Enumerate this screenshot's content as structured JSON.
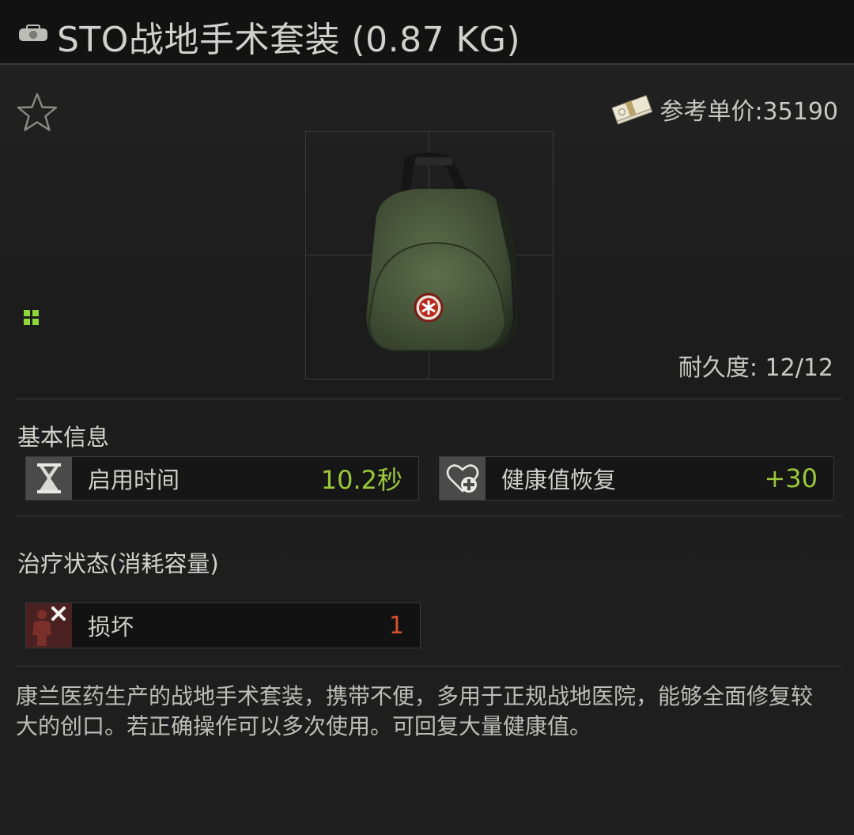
{
  "header": {
    "icon": "medkit-icon",
    "title": "STO战地手术套装 (0.87 KG)"
  },
  "top": {
    "favorite_icon": "star-outline-icon",
    "price_icon": "money-stack-icon",
    "price_label": "参考单价:35190",
    "grid_icon": "grid-squares-icon",
    "durability_label": "耐久度: 12/12"
  },
  "basic_info": {
    "title": "基本信息",
    "stats": [
      {
        "icon": "hourglass-icon",
        "label": "启用时间",
        "value": "10.2秒"
      },
      {
        "icon": "heart-plus-icon",
        "label": "健康值恢复",
        "value": "+30"
      }
    ]
  },
  "treatment": {
    "title": "治疗状态(消耗容量)",
    "effects": [
      {
        "icon": "fracture-body-icon",
        "label": "损坏",
        "value": "1"
      }
    ]
  },
  "description": "康兰医药生产的战地手术套装，携带不便，多用于正规战地医院，能够全面修复较大的创口。若正确操作可以多次使用。可回复大量健康值。",
  "colors": {
    "accent_green": "#9ac83a",
    "negative_red": "#d2522f",
    "background": "#1d1d1d"
  }
}
